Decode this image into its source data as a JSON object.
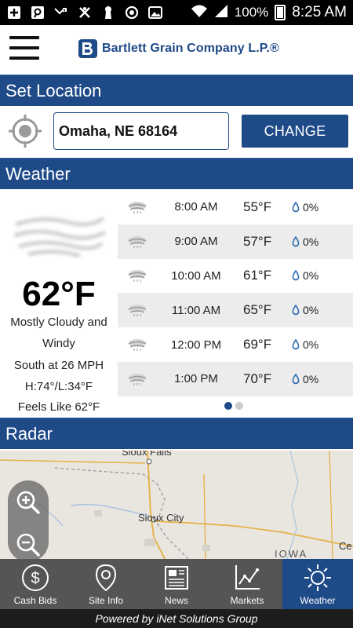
{
  "status_bar": {
    "battery": "100%",
    "time": "8:25 AM"
  },
  "header": {
    "brand": "Bartlett Grain Company L.P.®"
  },
  "location": {
    "section_title": "Set Location",
    "value": "Omaha, NE 68164",
    "change_label": "CHANGE"
  },
  "weather": {
    "section_title": "Weather",
    "current": {
      "temperature": "62°F",
      "condition_line1": "Mostly Cloudy and",
      "condition_line2": "Windy",
      "wind": "South at 26 MPH",
      "high_low": "H:74°/L:34°F",
      "feels_like": "Feels Like 62°F"
    },
    "forecast": [
      {
        "time": "8:00 AM",
        "temp": "55°F",
        "precip": "0%",
        "icon": "cloud-wind-icon"
      },
      {
        "time": "9:00 AM",
        "temp": "57°F",
        "precip": "0%",
        "icon": "cloud-wind-icon"
      },
      {
        "time": "10:00 AM",
        "temp": "61°F",
        "precip": "0%",
        "icon": "cloud-wind-icon"
      },
      {
        "time": "11:00 AM",
        "temp": "65°F",
        "precip": "0%",
        "icon": "cloud-wind-icon"
      },
      {
        "time": "12:00 PM",
        "temp": "69°F",
        "precip": "0%",
        "icon": "cloud-wind-icon"
      },
      {
        "time": "1:00 PM",
        "temp": "70°F",
        "precip": "0%",
        "icon": "cloud-wind-icon"
      }
    ],
    "page_indicator": {
      "current": 1,
      "total": 2
    }
  },
  "radar": {
    "section_title": "Radar",
    "labels": [
      "Sioux Falls",
      "Sioux City",
      "IOWA",
      "Ce"
    ]
  },
  "nav": [
    {
      "label": "Cash Bids",
      "icon": "dollar-icon"
    },
    {
      "label": "Site Info",
      "icon": "map-pin-icon"
    },
    {
      "label": "News",
      "icon": "newspaper-icon"
    },
    {
      "label": "Markets",
      "icon": "chart-icon"
    },
    {
      "label": "Weather",
      "icon": "sun-icon",
      "active": true
    }
  ],
  "footer": {
    "text": "Powered by iNet Solutions Group"
  },
  "colors": {
    "brand_blue": "#1e4a88",
    "nav_gray": "#555555"
  }
}
